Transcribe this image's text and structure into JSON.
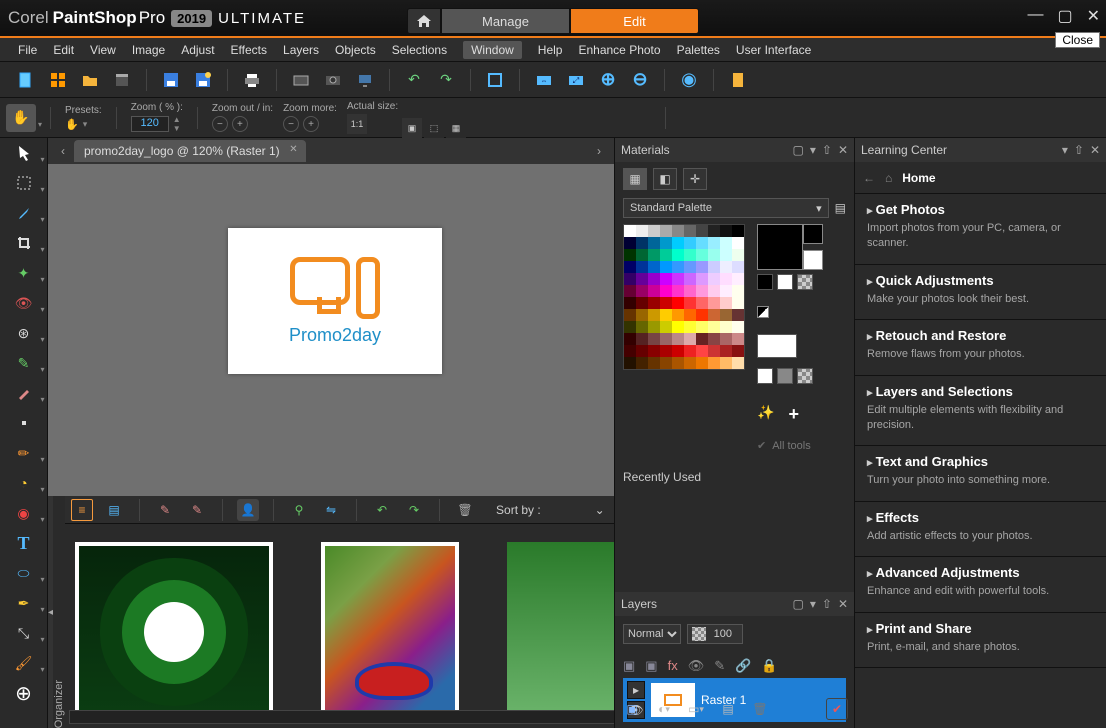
{
  "app": {
    "corel": "Corel",
    "ps": "PaintShop",
    "pro": "Pro",
    "year": "2019",
    "ultimate": "ULTIMATE",
    "home_icon": "home",
    "manage_label": "Manage",
    "edit_label": "Edit",
    "close_tip": "Close"
  },
  "menu": [
    "File",
    "Edit",
    "View",
    "Image",
    "Adjust",
    "Effects",
    "Layers",
    "Objects",
    "Selections",
    "Window",
    "Help",
    "Enhance Photo",
    "Palettes",
    "User Interface"
  ],
  "menu_active_index": 9,
  "zoom": {
    "presets_label": "Presets:",
    "zoom_pct_label": "Zoom ( % ):",
    "zoom_pct_value": "120",
    "zoom_out_in_label": "Zoom out / in:",
    "zoom_more_label": "Zoom more:",
    "actual_size_label": "Actual size:"
  },
  "doc": {
    "tab_label": "promo2day_logo @ 120% (Raster 1)",
    "logo_text": "Promo2day"
  },
  "organizer": {
    "side_label": "Organizer",
    "sort_by_label": "Sort by :"
  },
  "materials": {
    "title": "Materials",
    "palette_label": "Standard Palette",
    "alltools_label": "All tools",
    "recent_label": "Recently Used"
  },
  "layers": {
    "title": "Layers",
    "blend_mode": "Normal",
    "opacity": "100",
    "layer_name": "Raster 1"
  },
  "learn": {
    "title": "Learning Center",
    "home_label": "Home",
    "items": [
      {
        "title": "Get Photos",
        "desc": "Import photos from your PC, camera, or scanner."
      },
      {
        "title": "Quick Adjustments",
        "desc": "Make your photos look their best."
      },
      {
        "title": "Retouch and Restore",
        "desc": "Remove flaws from your photos."
      },
      {
        "title": "Layers and Selections",
        "desc": "Edit multiple elements with flexibility and precision."
      },
      {
        "title": "Text and Graphics",
        "desc": "Turn your photo into something more."
      },
      {
        "title": "Effects",
        "desc": "Add artistic effects to your photos."
      },
      {
        "title": "Advanced Adjustments",
        "desc": "Enhance and edit with powerful tools."
      },
      {
        "title": "Print and Share",
        "desc": "Print, e-mail, and share photos."
      }
    ]
  }
}
